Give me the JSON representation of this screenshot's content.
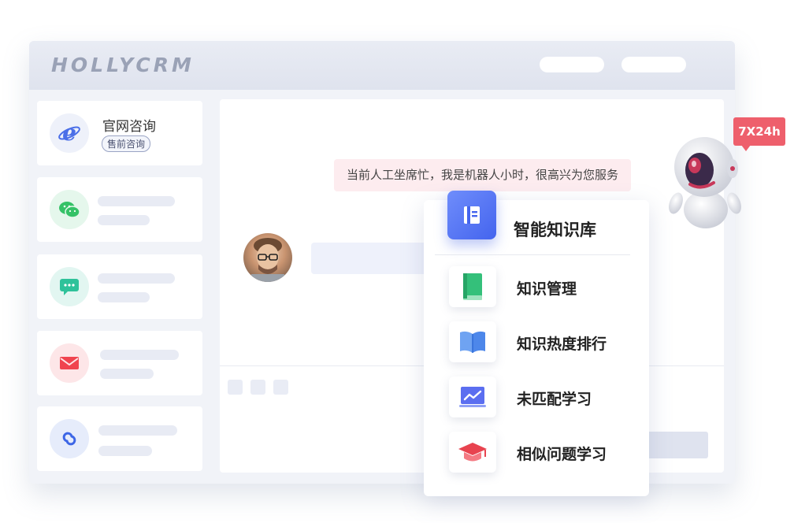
{
  "header": {
    "logo": "HOLLYCRM"
  },
  "sidebar": {
    "items": [
      {
        "title": "官网咨询",
        "tag": "售前咨询",
        "icon": "ie-browser-icon",
        "color": "#4a6ee8"
      },
      {
        "icon": "wechat-icon",
        "color": "#35c267"
      },
      {
        "icon": "chat-bubble-icon",
        "color": "#2ec29a"
      },
      {
        "icon": "mail-icon",
        "color": "#f0444f"
      },
      {
        "icon": "link-icon",
        "color": "#3d66e6"
      }
    ]
  },
  "chat": {
    "notice": "当前人工坐席忙，我是机器人小时，很高兴为您服务"
  },
  "knowledge": {
    "title": "智能知识库",
    "items": [
      {
        "label": "知识管理",
        "icon": "green-book-icon"
      },
      {
        "label": "知识热度排行",
        "icon": "open-book-icon"
      },
      {
        "label": "未匹配学习",
        "icon": "trend-chart-icon"
      },
      {
        "label": "相似问题学习",
        "icon": "graduation-cap-icon"
      }
    ]
  },
  "badge": {
    "text": "7X24h"
  },
  "colors": {
    "accent": "#4464ee",
    "badge": "#ee5f6c",
    "notice_bg": "#fdecef"
  }
}
